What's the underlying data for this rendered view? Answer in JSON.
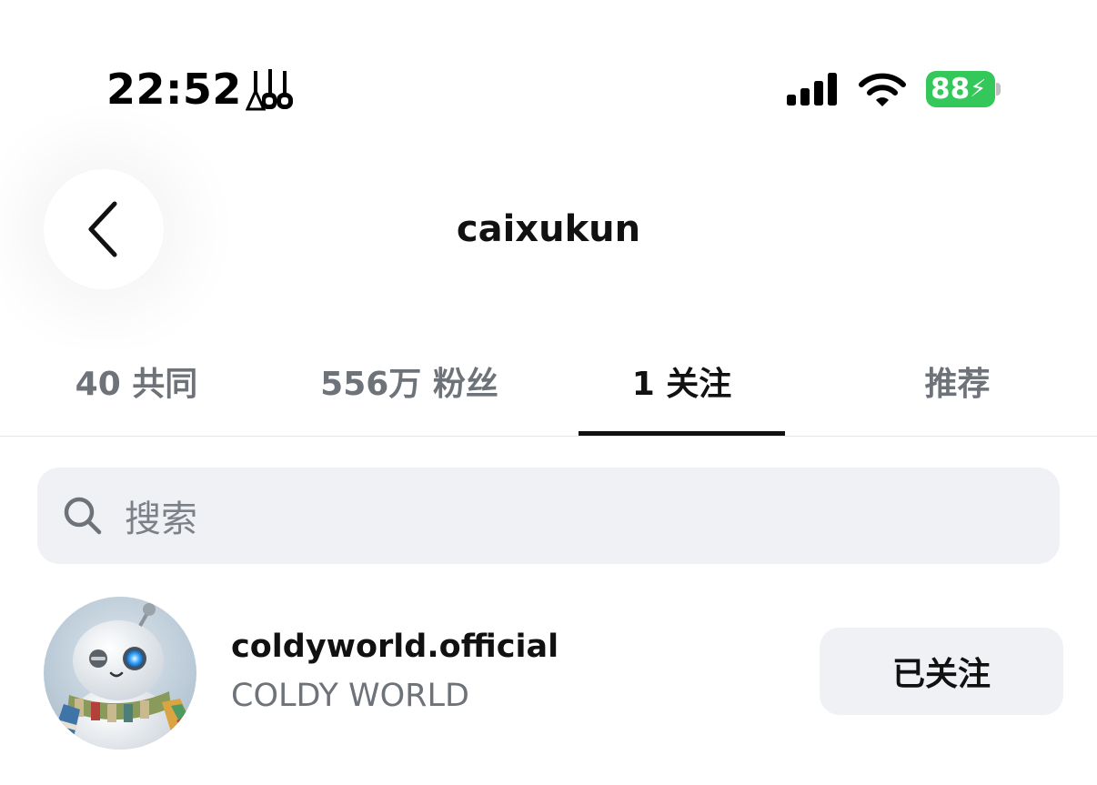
{
  "status_bar": {
    "time": "22:52",
    "battery": "88",
    "icons": {
      "app": "notification-app-icon",
      "signal": "cellular-signal-icon",
      "wifi": "wifi-icon",
      "battery": "battery-charging-icon"
    },
    "battery_color": "#34c759"
  },
  "header": {
    "title": "caixukun",
    "back_icon": "chevron-left-icon"
  },
  "tabs": [
    {
      "label": "40 共同",
      "active": false
    },
    {
      "label": "556万 粉丝",
      "active": false
    },
    {
      "label": "1 关注",
      "active": true
    },
    {
      "label": "推荐",
      "active": false
    }
  ],
  "search": {
    "placeholder": "搜索",
    "icon": "search-icon"
  },
  "following_list": [
    {
      "username": "coldyworld.official",
      "display_name": "COLDY WORLD",
      "button_label": "已关注",
      "avatar": "robot-snowman-avatar"
    }
  ],
  "colors": {
    "text_primary": "#111111",
    "text_secondary": "#6e737a",
    "surface": "#eff1f5",
    "battery_green": "#34c759"
  }
}
